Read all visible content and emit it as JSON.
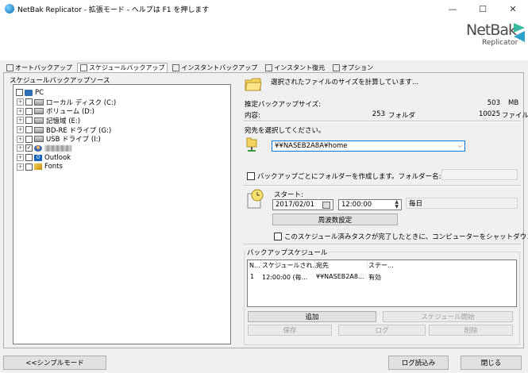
{
  "window": {
    "title": "NetBak Replicator - 拡張モード - ヘルプは F1 を押します",
    "minimize": "—",
    "maximize": "☐",
    "close": "✕"
  },
  "logo": {
    "main": "NetBak",
    "sub": "Replicator",
    "accent_color": "#3bb9a0"
  },
  "tabs": [
    {
      "label": "オートバックアップ",
      "active": false
    },
    {
      "label": "スケジュールバックアップ",
      "active": true
    },
    {
      "label": "インスタントバックアップ",
      "active": false
    },
    {
      "label": "インスタント復元",
      "active": false
    },
    {
      "label": "オプション",
      "active": false
    }
  ],
  "source": {
    "label": "スケジュールバックアップソース",
    "tree": [
      {
        "label": "PC",
        "icon": "pc-icon",
        "checked": false,
        "level": 0,
        "expander": "⊟"
      },
      {
        "label": "ローカル ディスク (C:)",
        "icon": "drive-icon",
        "checked": false,
        "level": 1,
        "expander": "+"
      },
      {
        "label": "ボリューム (D:)",
        "icon": "drive-icon",
        "checked": false,
        "level": 1,
        "expander": "+"
      },
      {
        "label": "記憶域 (E:)",
        "icon": "drive-icon",
        "checked": false,
        "level": 1,
        "expander": "+"
      },
      {
        "label": "BD-RE ドライブ (G:)",
        "icon": "drive-icon",
        "checked": false,
        "level": 1,
        "expander": "+"
      },
      {
        "label": "USB ドライブ (I:)",
        "icon": "drive-icon",
        "checked": false,
        "level": 1,
        "expander": "+"
      },
      {
        "label": "",
        "icon": "user-icon",
        "checked": true,
        "level": 1,
        "expander": "+",
        "blurred": true
      },
      {
        "label": "Outlook",
        "icon": "outlook-icon",
        "checked": false,
        "level": 1,
        "expander": "+"
      },
      {
        "label": "Fonts",
        "icon": "fonts-icon",
        "checked": false,
        "level": 1,
        "expander": "+"
      }
    ]
  },
  "size_info": {
    "calculating": "選択されたファイルのサイズを計算しています...",
    "estimated_label": "推定バックアップサイズ:",
    "estimated_value": "503",
    "estimated_unit": "MB",
    "contents_label": "内容:",
    "folders_count": "253",
    "folders_label": "フォルダ",
    "files_count": "10025",
    "files_label": "ファイル"
  },
  "destination": {
    "label": "宛先を選択してください。",
    "value": "¥¥NASEB2A8A¥home",
    "create_folder_label": "バックアップごとにフォルダーを作成します。フォルダー名:",
    "folder_name": ""
  },
  "start": {
    "label": "スタート:",
    "date": "2017/02/01",
    "time": "12:00:00",
    "frequency_text": "毎日",
    "frequency_button": "周波数設定",
    "shutdown_label": "このスケジュール済みタスクが完了したときに、コンピューターをシャットダウンする"
  },
  "schedule": {
    "label": "バックアップスケジュール",
    "columns": [
      "N...",
      "スケジュールされ...",
      "宛先",
      "ステー..."
    ],
    "rows": [
      [
        "1",
        "12:00:00 (毎...",
        "¥¥NASEB2A8...",
        "有効"
      ]
    ]
  },
  "actions": {
    "add": "追加",
    "start_schedule": "スケジュール開始",
    "save": "保存",
    "log": "ログ",
    "delete": "削除"
  },
  "footer": {
    "simple_mode": "<<シンプルモード",
    "read_log": "ログ読込み",
    "close": "閉じる"
  }
}
